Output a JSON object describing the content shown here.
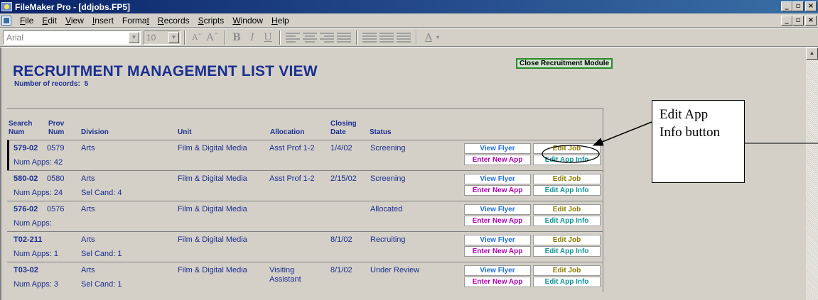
{
  "window": {
    "title": "FileMaker Pro - [ddjobs.FP5]",
    "controls": [
      "_",
      "▫",
      "×"
    ]
  },
  "menubar": {
    "items": [
      {
        "label": "File",
        "key": "F"
      },
      {
        "label": "Edit",
        "key": "E"
      },
      {
        "label": "View",
        "key": "V"
      },
      {
        "label": "Insert",
        "key": "I"
      },
      {
        "label": "Format",
        "key": "t"
      },
      {
        "label": "Records",
        "key": "R"
      },
      {
        "label": "Scripts",
        "key": "S"
      },
      {
        "label": "Window",
        "key": "W"
      },
      {
        "label": "Help",
        "key": "H"
      }
    ]
  },
  "toolbar": {
    "font": "Arial",
    "size": "10",
    "icons": [
      "font-size-decrease-icon",
      "font-size-increase-icon",
      "bold-icon",
      "italic-icon",
      "underline-icon",
      "align-left-icon",
      "align-center-icon",
      "align-right-icon",
      "align-justify-icon",
      "line-spacing-icon",
      "decrease-spacing-icon",
      "increase-spacing-icon",
      "text-color-icon"
    ]
  },
  "page": {
    "title": "RECRUITMENT MANAGEMENT LIST VIEW",
    "record_count_label": "Number of records:",
    "record_count": "5",
    "close_button": "Close Recruitment Module"
  },
  "table": {
    "headers": {
      "search": "Search\nNum",
      "prov": "Prov\nNum",
      "division": "Division",
      "unit": "Unit",
      "allocation": "Allocation",
      "closing": "Closing\nDate",
      "status": "Status"
    },
    "buttons": {
      "view_flyer": "View Flyer",
      "edit_job": "Edit Job",
      "enter_new_app": "Enter New App",
      "edit_app_info": "Edit App Info"
    },
    "rows": [
      {
        "search": "579-02",
        "prov": "0579",
        "division": "Arts",
        "unit": "Film & Digital Media",
        "allocation": "Asst Prof 1-2",
        "allocation2": "",
        "closing": "1/4/02",
        "status": "Screening",
        "num_apps": "Num Apps: 42",
        "sel_cand": ""
      },
      {
        "search": "580-02",
        "prov": "0580",
        "division": "Arts",
        "unit": "Film & Digital Media",
        "allocation": "Asst Prof 1-2",
        "allocation2": "",
        "closing": "2/15/02",
        "status": "Screening",
        "num_apps": "Num Apps: 24",
        "sel_cand": "Sel Cand: 4"
      },
      {
        "search": "576-02",
        "prov": "0576",
        "division": "Arts",
        "unit": "Film & Digital Media",
        "allocation": "",
        "allocation2": "",
        "closing": "",
        "status": "Allocated",
        "num_apps": "Num Apps:",
        "sel_cand": ""
      },
      {
        "search": "T02-211",
        "prov": "",
        "division": "Arts",
        "unit": "Film & Digital Media",
        "allocation": "",
        "allocation2": "",
        "closing": "8/1/02",
        "status": "Recruiting",
        "num_apps": "Num Apps: 1",
        "sel_cand": "Sel Cand: 1"
      },
      {
        "search": "T03-02",
        "prov": "",
        "division": "Arts",
        "unit": "Film & Digital Media",
        "allocation": "Visiting",
        "allocation2": "Assistant",
        "closing": "8/1/02",
        "status": "Under Review",
        "num_apps": "Num Apps: 3",
        "sel_cand": "Sel Cand: 1"
      }
    ]
  },
  "annotation": {
    "line1": "Edit App",
    "line2": "Info button"
  }
}
